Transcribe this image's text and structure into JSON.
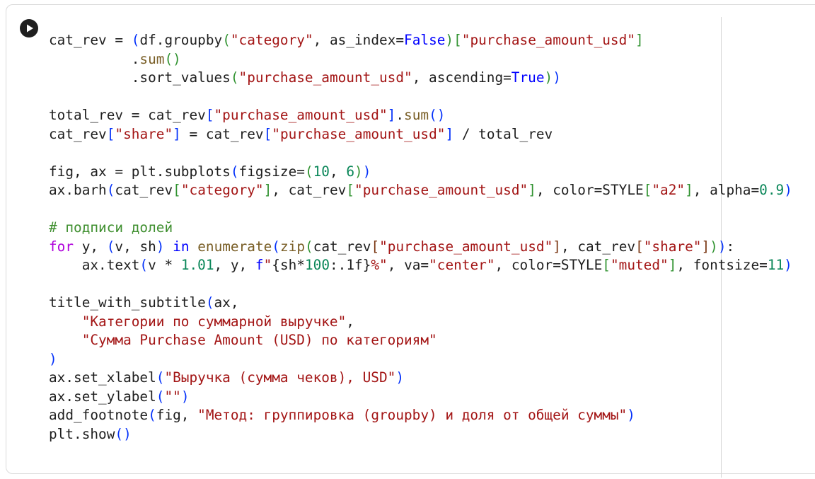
{
  "cell": {
    "run_button_icon": "play-icon",
    "lines": [
      [
        [
          "cat_rev = ",
          ""
        ],
        [
          "(",
          "p1"
        ],
        [
          "df.groupby",
          ""
        ],
        [
          "(",
          "p2"
        ],
        [
          "\"category\"",
          "s"
        ],
        [
          ", as_index=",
          ""
        ],
        [
          "False",
          "b"
        ],
        [
          ")",
          "p2"
        ],
        [
          "[",
          "p2"
        ],
        [
          "\"purchase_amount_usd\"",
          "s"
        ],
        [
          "]",
          "p2"
        ]
      ],
      [
        [
          "          .",
          ""
        ],
        [
          "sum",
          "f"
        ],
        [
          "()",
          "p2"
        ]
      ],
      [
        [
          "          .sort_values",
          ""
        ],
        [
          "(",
          "p2"
        ],
        [
          "\"purchase_amount_usd\"",
          "s"
        ],
        [
          ", ascending=",
          ""
        ],
        [
          "True",
          "b"
        ],
        [
          ")",
          "p2"
        ],
        [
          ")",
          "p1"
        ]
      ],
      [],
      [
        [
          "total_rev = cat_rev",
          ""
        ],
        [
          "[",
          "p1"
        ],
        [
          "\"purchase_amount_usd\"",
          "s"
        ],
        [
          "]",
          "p1"
        ],
        [
          ".",
          ""
        ],
        [
          "sum",
          "f"
        ],
        [
          "()",
          "p1"
        ]
      ],
      [
        [
          "cat_rev",
          ""
        ],
        [
          "[",
          "p1"
        ],
        [
          "\"share\"",
          "s"
        ],
        [
          "]",
          "p1"
        ],
        [
          " = cat_rev",
          ""
        ],
        [
          "[",
          "p1"
        ],
        [
          "\"purchase_amount_usd\"",
          "s"
        ],
        [
          "]",
          "p1"
        ],
        [
          " / total_rev",
          ""
        ]
      ],
      [],
      [
        [
          "fig, ax = plt.subplots",
          ""
        ],
        [
          "(",
          "p1"
        ],
        [
          "figsize=",
          ""
        ],
        [
          "(",
          "p2"
        ],
        [
          "10",
          "n"
        ],
        [
          ", ",
          ""
        ],
        [
          "6",
          "n"
        ],
        [
          ")",
          "p2"
        ],
        [
          ")",
          "p1"
        ]
      ],
      [
        [
          "ax.barh",
          ""
        ],
        [
          "(",
          "p1"
        ],
        [
          "cat_rev",
          ""
        ],
        [
          "[",
          "p2"
        ],
        [
          "\"category\"",
          "s"
        ],
        [
          "]",
          "p2"
        ],
        [
          ", cat_rev",
          ""
        ],
        [
          "[",
          "p2"
        ],
        [
          "\"purchase_amount_usd\"",
          "s"
        ],
        [
          "]",
          "p2"
        ],
        [
          ", color=STYLE",
          ""
        ],
        [
          "[",
          "p2"
        ],
        [
          "\"a2\"",
          "s"
        ],
        [
          "]",
          "p2"
        ],
        [
          ", alpha=",
          ""
        ],
        [
          "0.9",
          "n"
        ],
        [
          ")",
          "p1"
        ]
      ],
      [],
      [
        [
          "# подписи долей",
          "c"
        ]
      ],
      [
        [
          "for",
          "k"
        ],
        [
          " y, ",
          ""
        ],
        [
          "(",
          "p1"
        ],
        [
          "v, sh",
          ""
        ],
        [
          ")",
          "p1"
        ],
        [
          " ",
          ""
        ],
        [
          "in",
          "b"
        ],
        [
          " ",
          ""
        ],
        [
          "enumerate",
          "f"
        ],
        [
          "(",
          "p1"
        ],
        [
          "zip",
          "f"
        ],
        [
          "(",
          "p2"
        ],
        [
          "cat_rev",
          ""
        ],
        [
          "[",
          "p3"
        ],
        [
          "\"purchase_amount_usd\"",
          "s"
        ],
        [
          "]",
          "p3"
        ],
        [
          ", cat_rev",
          ""
        ],
        [
          "[",
          "p3"
        ],
        [
          "\"share\"",
          "s"
        ],
        [
          "]",
          "p3"
        ],
        [
          ")",
          "p2"
        ],
        [
          ")",
          "p1"
        ],
        [
          ":",
          ""
        ]
      ],
      [
        [
          "    ax.text",
          ""
        ],
        [
          "(",
          "p1"
        ],
        [
          "v * ",
          ""
        ],
        [
          "1.01",
          "n"
        ],
        [
          ", y, ",
          ""
        ],
        [
          "f",
          "b"
        ],
        [
          "\"",
          "s"
        ],
        [
          "{sh*",
          ""
        ],
        [
          "100",
          "n"
        ],
        [
          ":.1f}",
          ""
        ],
        [
          "%\"",
          "s"
        ],
        [
          ", va=",
          ""
        ],
        [
          "\"center\"",
          "s"
        ],
        [
          ", color=STYLE",
          ""
        ],
        [
          "[",
          "p2"
        ],
        [
          "\"muted\"",
          "s"
        ],
        [
          "]",
          "p2"
        ],
        [
          ", fontsize=",
          ""
        ],
        [
          "11",
          "n"
        ],
        [
          ")",
          "p1"
        ]
      ],
      [],
      [
        [
          "title_with_subtitle",
          ""
        ],
        [
          "(",
          "p1"
        ],
        [
          "ax,",
          ""
        ]
      ],
      [
        [
          "    ",
          ""
        ],
        [
          "\"Категории по суммарной выручке\"",
          "s"
        ],
        [
          ",",
          ""
        ]
      ],
      [
        [
          "    ",
          ""
        ],
        [
          "\"Сумма Purchase Amount (USD) по категориям\"",
          "s"
        ]
      ],
      [
        [
          ")",
          "p1"
        ]
      ],
      [
        [
          "ax.set_xlabel",
          ""
        ],
        [
          "(",
          "p1"
        ],
        [
          "\"Выручка (сумма чеков), USD\"",
          "s"
        ],
        [
          ")",
          "p1"
        ]
      ],
      [
        [
          "ax.set_ylabel",
          ""
        ],
        [
          "(",
          "p1"
        ],
        [
          "\"\"",
          "s"
        ],
        [
          ")",
          "p1"
        ]
      ],
      [
        [
          "add_footnote",
          ""
        ],
        [
          "(",
          "p1"
        ],
        [
          "fig, ",
          ""
        ],
        [
          "\"Метод: группировка (groupby) и доля от общей суммы\"",
          "s"
        ],
        [
          ")",
          "p1"
        ]
      ],
      [
        [
          "plt.show",
          ""
        ],
        [
          "()",
          "p1"
        ]
      ]
    ]
  }
}
